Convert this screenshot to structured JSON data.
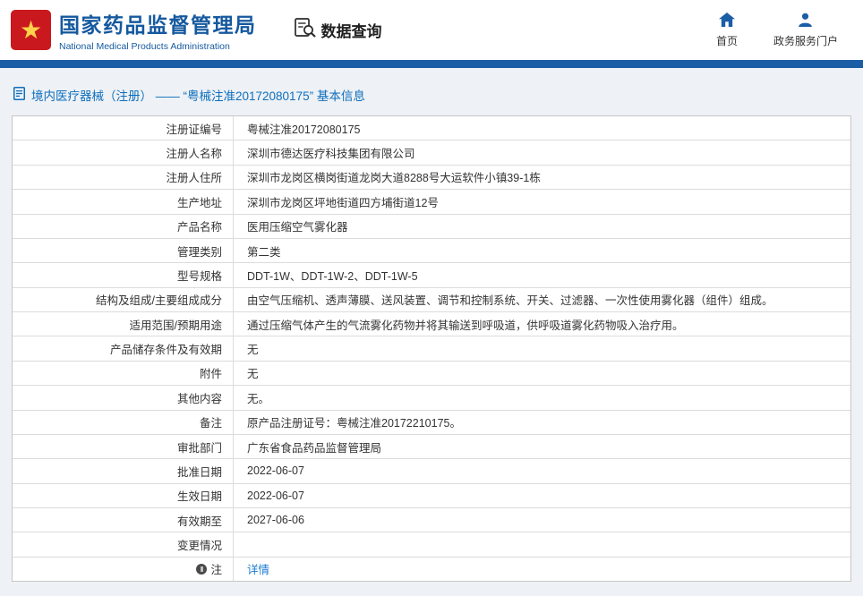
{
  "header": {
    "org_name_cn": "国家药品监督管理局",
    "org_name_en": "National Medical Products Administration",
    "module_title": "数据查询",
    "nav": [
      {
        "label": "首页",
        "icon": "home-icon"
      },
      {
        "label": "政务服务门户",
        "icon": "user-icon"
      }
    ],
    "accent_color": "#1b5ea6",
    "emblem_color": "#c9191e"
  },
  "breadcrumb": {
    "text": "境内医疗器械（注册） ——  “粤械注准20172080175” 基本信息"
  },
  "table": {
    "rows": [
      {
        "label": "注册证编号",
        "value": "粤械注准20172080175"
      },
      {
        "label": "注册人名称",
        "value": "深圳市德达医疗科技集团有限公司"
      },
      {
        "label": "注册人住所",
        "value": "深圳市龙岗区横岗街道龙岗大道8288号大运软件小镇39-1栋"
      },
      {
        "label": "生产地址",
        "value": "深圳市龙岗区坪地街道四方埔街道12号"
      },
      {
        "label": "产品名称",
        "value": "医用压缩空气雾化器"
      },
      {
        "label": "管理类别",
        "value": "第二类"
      },
      {
        "label": "型号规格",
        "value": "DDT-1W、DDT-1W-2、DDT-1W-5"
      },
      {
        "label": "结构及组成/主要组成成分",
        "value": "由空气压缩机、透声薄膜、送风装置、调节和控制系统、开关、过滤器、一次性使用雾化器（组件）组成。"
      },
      {
        "label": "适用范围/预期用途",
        "value": "通过压缩气体产生的气流雾化药物并将其输送到呼吸道，供呼吸道雾化药物吸入治疗用。"
      },
      {
        "label": "产品储存条件及有效期",
        "value": "无"
      },
      {
        "label": "附件",
        "value": "无"
      },
      {
        "label": "其他内容",
        "value": "无。"
      },
      {
        "label": "备注",
        "value": "原产品注册证号：粤械注准20172210175。"
      },
      {
        "label": "审批部门",
        "value": "广东省食品药品监督管理局"
      },
      {
        "label": "批准日期",
        "value": "2022-06-07"
      },
      {
        "label": "生效日期",
        "value": "2022-06-07"
      },
      {
        "label": "有效期至",
        "value": "2027-06-06"
      },
      {
        "label": "变更情况",
        "value": ""
      },
      {
        "label": "注",
        "value": "详情"
      }
    ]
  }
}
